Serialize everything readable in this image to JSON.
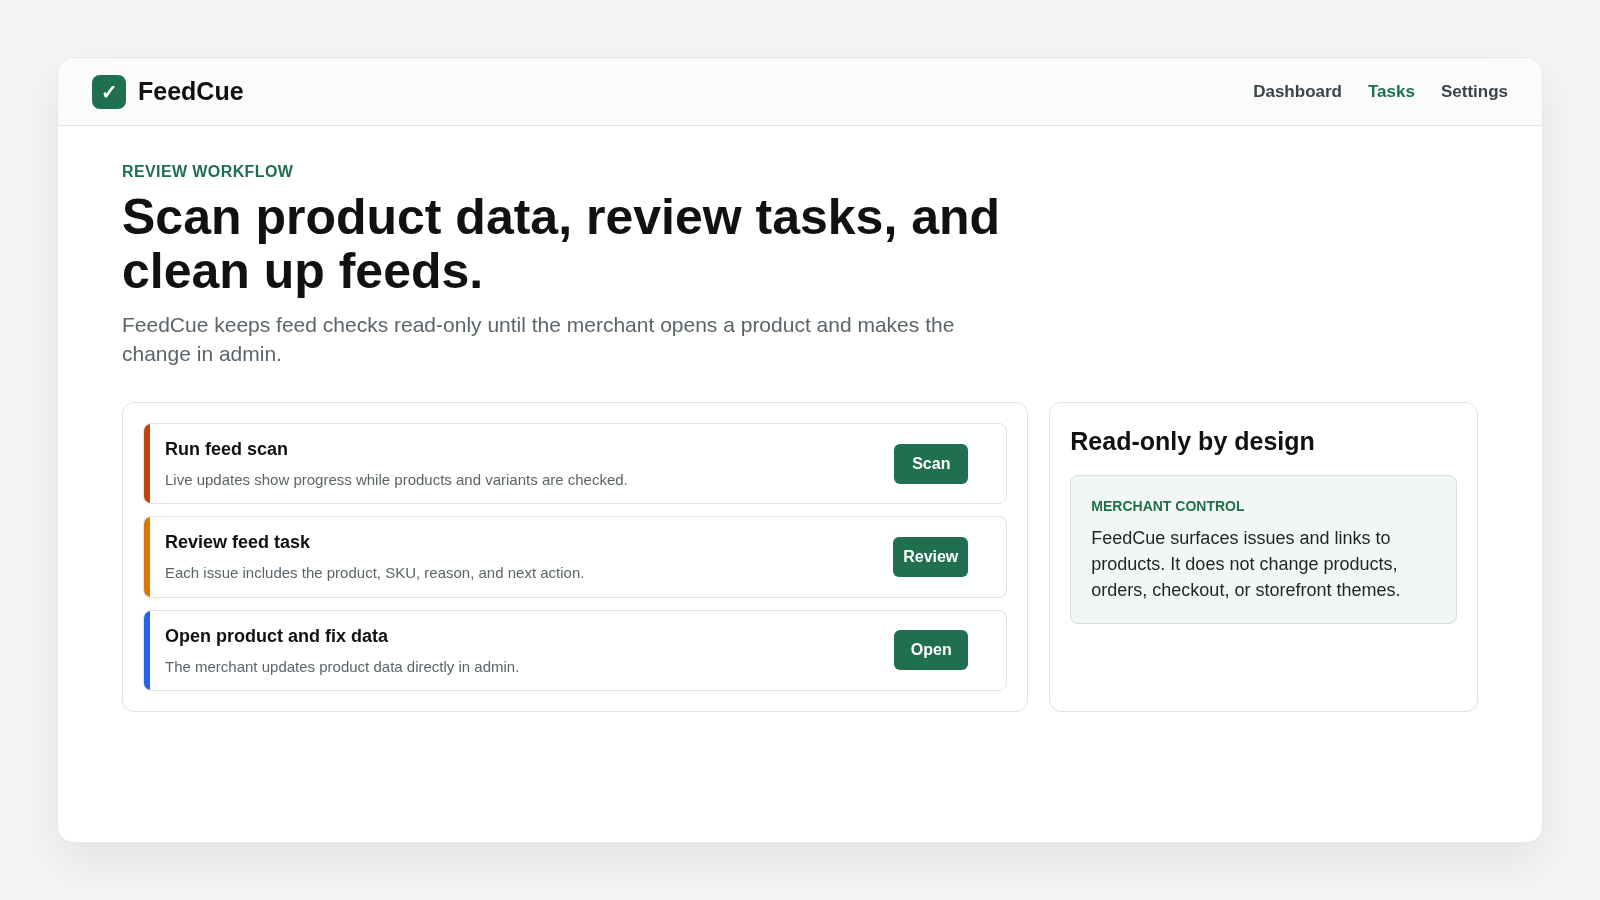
{
  "brand": {
    "logo": "✓",
    "name": "FeedCue"
  },
  "nav": [
    {
      "label": "Dashboard",
      "selected": false
    },
    {
      "label": "Tasks",
      "selected": true
    },
    {
      "label": "Settings",
      "selected": false
    }
  ],
  "hero": {
    "eyebrow": "REVIEW WORKFLOW",
    "title": "Scan product data, review tasks, and clean up feeds.",
    "subtitle": "FeedCue keeps feed checks read-only until the merchant opens a product and makes the change in admin."
  },
  "steps": [
    {
      "title": "Run feed scan",
      "description": "Live updates show progress while products and variants are checked.",
      "action": "Scan",
      "color": "#c2410c"
    },
    {
      "title": "Review feed task",
      "description": "Each issue includes the product, SKU, reason, and next action.",
      "action": "Review",
      "color": "#d97706"
    },
    {
      "title": "Open product and fix data",
      "description": "The merchant updates product data directly in admin.",
      "action": "Open",
      "color": "#2563eb"
    }
  ],
  "aside": {
    "title": "Read-only by design",
    "note_label": "MERCHANT CONTROL",
    "note_text": "FeedCue surfaces issues and links to products. It does not change products, orders, checkout, or storefront themes."
  }
}
